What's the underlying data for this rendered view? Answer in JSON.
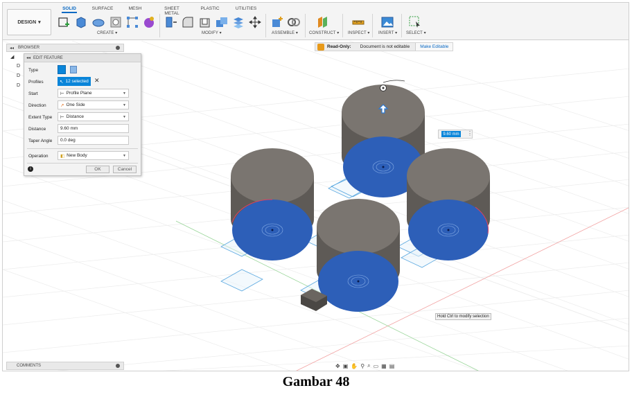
{
  "toolbar": {
    "workspace": "DESIGN",
    "tabs": [
      {
        "label": "SOLID",
        "active": true
      },
      {
        "label": "SURFACE",
        "active": false
      },
      {
        "label": "MESH",
        "active": false
      },
      {
        "label": "SHEET METAL",
        "active": false
      },
      {
        "label": "PLASTIC",
        "active": false
      },
      {
        "label": "UTILITIES",
        "active": false
      }
    ],
    "groups": [
      "CREATE ▾",
      "MODIFY ▾",
      "ASSEMBLE ▾",
      "CONSTRUCT ▾",
      "INSPECT ▾",
      "INSERT ▾",
      "SELECT ▾"
    ]
  },
  "status": {
    "read_only_label": "Read-Only:",
    "message": "Document is not editable",
    "make_editable": "Make Editable"
  },
  "browser": {
    "title": "BROWSER",
    "tree_initials": [
      "D",
      "D",
      "D"
    ]
  },
  "edit_feature": {
    "title": "EDIT FEATURE",
    "type_label": "Type",
    "profiles_label": "Profiles",
    "profiles_value": "12 selected",
    "start_label": "Start",
    "start_value": "Profile Plane",
    "direction_label": "Direction",
    "direction_value": "One Side",
    "extent_label": "Extent Type",
    "extent_value": "Distance",
    "distance_label": "Distance",
    "distance_value": "9.60 mm",
    "taper_label": "Taper Angle",
    "taper_value": "0.0 deg",
    "operation_label": "Operation",
    "operation_value": "New Body",
    "ok": "OK",
    "cancel": "Cancel"
  },
  "canvas": {
    "distance_manipulator": "9.60 mm",
    "hint": "Hold Ctrl to modify selection",
    "colors": {
      "cylinder_top": "#7a7570",
      "cylinder_body": "#5c5855",
      "selected_face": "#2d5fb8",
      "grid": "#e2e2e2"
    }
  },
  "comments": {
    "title": "COMMENTS"
  },
  "caption": "Gambar 48"
}
